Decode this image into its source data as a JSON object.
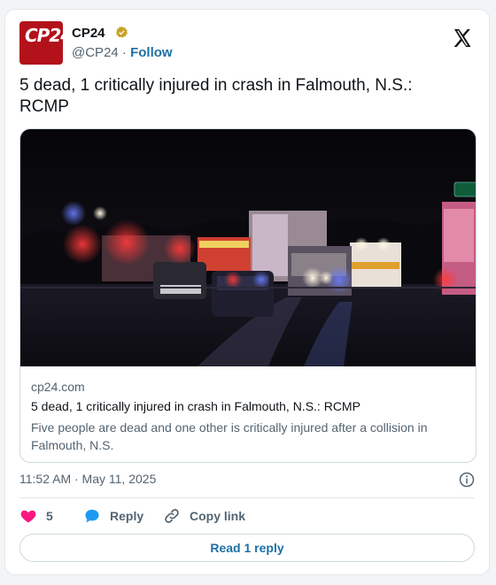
{
  "author": {
    "name": "CP24",
    "avatar_text": "CP24",
    "handle": "@CP24",
    "separator": "·",
    "follow_label": "Follow"
  },
  "tweet": {
    "text": "5 dead, 1 critically injured in crash in Falmouth, N.S.: RCMP",
    "timestamp": "11:52 AM · May 11, 2025"
  },
  "link_card": {
    "domain": "cp24.com",
    "title": "5 dead, 1 critically injured in crash in Falmouth, N.S.: RCMP",
    "description": "Five people are dead and one other is critically injured after a collision in Falmouth, N.S."
  },
  "actions": {
    "like_count": "5",
    "reply_label": "Reply",
    "copy_link_label": "Copy link",
    "read_replies_label": "Read 1 reply"
  },
  "icons": {
    "verified": "verified-badge-icon",
    "x_logo": "x-logo-icon",
    "info": "info-icon",
    "heart": "heart-icon",
    "reply": "reply-bubble-icon",
    "link": "link-icon"
  },
  "colors": {
    "brand_red": "#b3121b",
    "link_blue": "#1d6fa5",
    "heart_pink": "#f91880",
    "muted": "#536471"
  }
}
